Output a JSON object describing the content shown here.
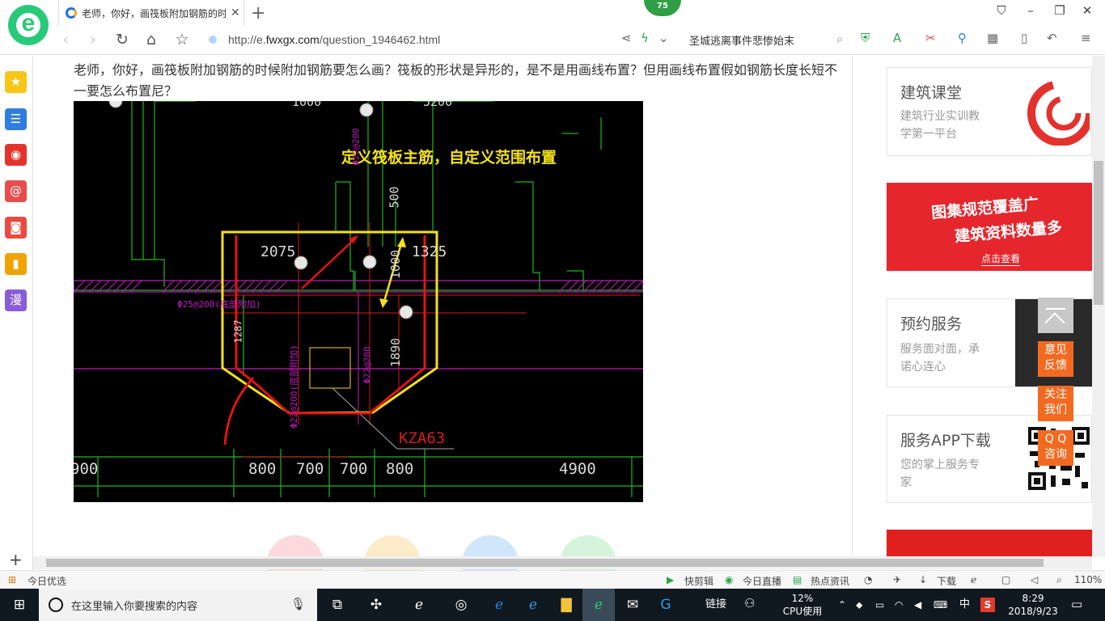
{
  "browser": {
    "tab_title": "老师，你好，画筏板附加钢筋的时候附加钢筋要怎么画？",
    "badge": "75",
    "url_prefix": "http://e.",
    "url_domain": "fwxgx.com",
    "url_path": "/question_1946462.html",
    "search_text": "圣城逃离事件悲惨始末",
    "logo_letter": "e"
  },
  "sidebar": {
    "items": [
      {
        "icon": "star-icon",
        "color": "#f5c518",
        "glyph": "★"
      },
      {
        "icon": "news-icon",
        "color": "#2f7de1",
        "glyph": "☰"
      },
      {
        "icon": "weibo-icon",
        "color": "#e6332a",
        "glyph": "◉"
      },
      {
        "icon": "mail-icon",
        "color": "#e84d4d",
        "glyph": "@"
      },
      {
        "icon": "game-icon",
        "color": "#e94a3f",
        "glyph": "◙"
      },
      {
        "icon": "note-icon",
        "color": "#f0a300",
        "glyph": "▮"
      },
      {
        "icon": "comic-icon",
        "color": "#8a5cd6",
        "glyph": "漫"
      }
    ]
  },
  "content": {
    "question": "老师，你好，画筏板附加钢筋的时候附加钢筋要怎么画？筏板的形状是异形的，是不是用画线布置？但用画线布置假如钢筋长度长短不一要怎么布置尼？"
  },
  "cad": {
    "caption": "定义筏板主筋，自定义范围布置",
    "dims_top": [
      "1000",
      "5200"
    ],
    "dim_2075": "2075",
    "dim_1325": "1325",
    "dim_500": "500",
    "dim_1000": "1000",
    "dim_1890": "1890",
    "dim_1287": "1287",
    "rebar_left": "Φ25@200(底部附加)",
    "rebar_vert1": "Φ22@200",
    "rebar_vert2": "Φ22@200(底部附加)",
    "rebar_top": "Φ22@200",
    "column": "KZA63",
    "dims_bottom": [
      "900",
      "800",
      "700",
      "700",
      "800",
      "4900"
    ]
  },
  "right": {
    "card1": {
      "title": "建筑课堂",
      "desc1": "建筑行业实训教",
      "desc2": "学第一平台"
    },
    "banner": {
      "line1": "图集规范覆盖广",
      "line2": "建筑资料数量多",
      "link": "点击查看"
    },
    "card2": {
      "title": "预约服务",
      "desc1": "服务面对面，承",
      "desc2": "诺心连心"
    },
    "card3": {
      "title": "服务APP下载",
      "desc1": "您的掌上服务专",
      "desc2": "家"
    },
    "float": {
      "feedback1": "意见",
      "feedback2": "反馈",
      "follow1": "关注",
      "follow2": "我们",
      "qq1": "Q Q",
      "qq2": "咨询"
    }
  },
  "statusbar": {
    "left": "今日优选",
    "clip": "快剪辑",
    "live": "今日直播",
    "news": "热点资讯",
    "download": "下载",
    "zoom": "110%"
  },
  "taskbar": {
    "search_placeholder": "在这里输入你要搜索的内容",
    "links": "链接",
    "cpu_percent": "12%",
    "cpu_label": "CPU使用",
    "ime": "中",
    "time": "8:29",
    "date": "2018/9/23"
  }
}
